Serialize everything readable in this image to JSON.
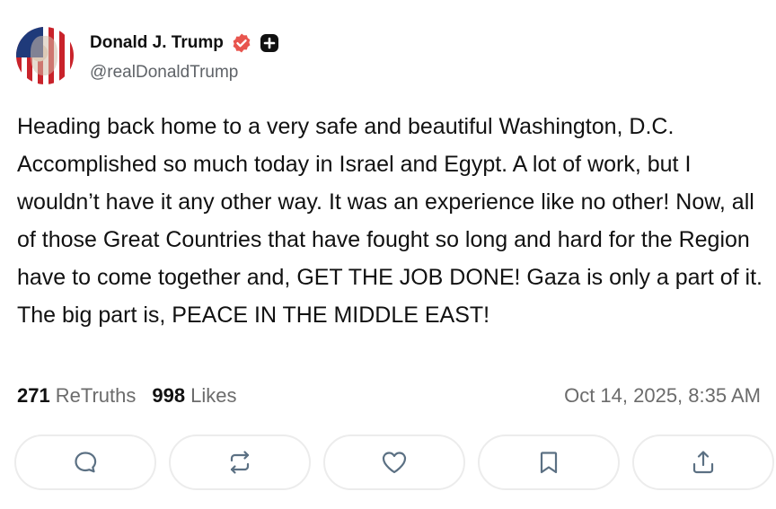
{
  "post": {
    "author": {
      "display_name": "Donald J. Trump",
      "handle": "@realDonaldTrump"
    },
    "text": "Heading back home to a very safe and beautiful Washington, D.C. Accomplished so much today in Israel and Egypt. A lot of work, but I wouldn’t have it any other way. It was an experience like no other! Now, all of those Great Countries that have fought so long and hard for the Region have to come together and, GET THE JOB DONE! Gaza is only a part of it. The big part is, PEACE IN THE MIDDLE EAST!",
    "stats": {
      "retruths_count": "271",
      "retruths_label": "ReTruths",
      "likes_count": "998",
      "likes_label": "Likes"
    },
    "timestamp": "Oct 14, 2025, 8:35 AM"
  },
  "icons": {
    "verified": "verified-badge-icon",
    "plus": "plus-badge-icon",
    "reply": "reply-icon",
    "retruth": "retruth-icon",
    "like": "heart-icon",
    "bookmark": "bookmark-icon",
    "share": "share-icon"
  },
  "colors": {
    "verified_badge": "#e8554e",
    "text": "#111111",
    "muted": "#6b6b6b",
    "button_border": "#ececec",
    "icon": "#5b7083"
  }
}
